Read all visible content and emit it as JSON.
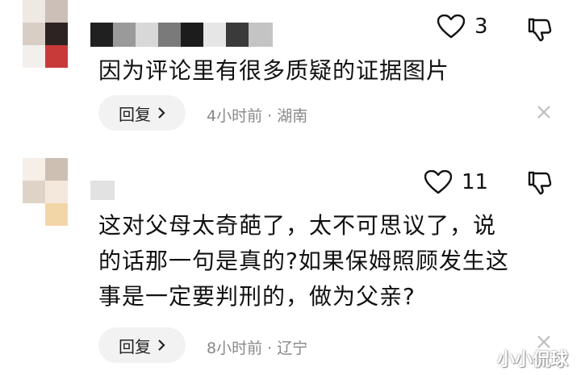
{
  "comments": [
    {
      "likes": "3",
      "text_lines": [
        "因为评论里有很多质疑的证据图片"
      ],
      "reply_label": "回复",
      "meta": "4小时前 · 湖南"
    },
    {
      "likes": "11",
      "text_lines": [
        "这对父母太奇葩了，太不可思议了，说",
        "的话那一句是真的?如果保姆照顾发生这",
        "事是一定要判刑的，做为父亲?"
      ],
      "reply_label": "回复",
      "meta": "8小时前 · 辽宁"
    }
  ],
  "watermark": "小小侃球",
  "icons": {
    "like": "heart-icon",
    "dislike": "thumbs-down-icon",
    "reply_arrow": "chevron-right-icon",
    "dismiss": "close-icon"
  }
}
